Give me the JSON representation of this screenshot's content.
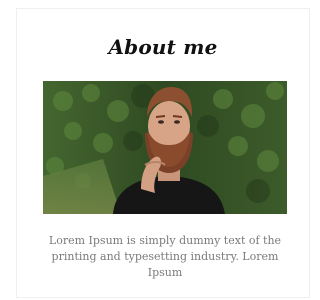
{
  "about": {
    "title": "About me",
    "bio": "Lorem Ipsum is simply dummy text of the printing and typesetting industry. Lorem Ipsum"
  }
}
